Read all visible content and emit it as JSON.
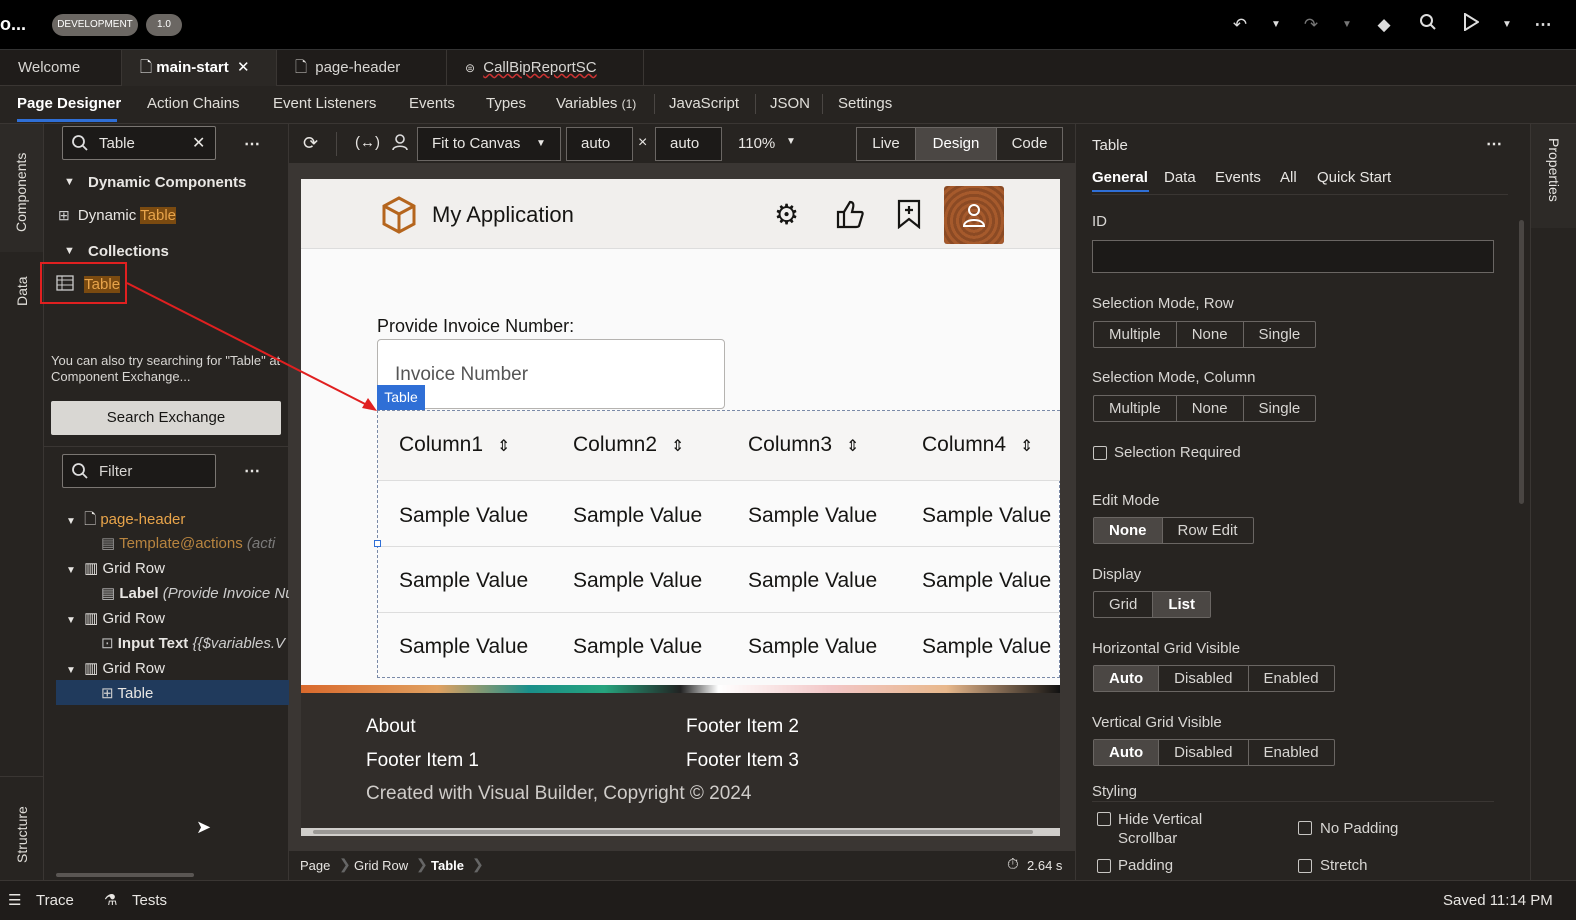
{
  "topbar": {
    "app_name": "o...",
    "env_badge": "DEVELOPMENT",
    "version_badge": "1.0"
  },
  "file_tabs": [
    {
      "label": "Welcome"
    },
    {
      "label": "main-start"
    },
    {
      "label": "page-header"
    },
    {
      "label": "CallBipReportSC"
    }
  ],
  "sub_tabs": [
    {
      "label": "Page Designer"
    },
    {
      "label": "Action Chains"
    },
    {
      "label": "Event Listeners"
    },
    {
      "label": "Events"
    },
    {
      "label": "Types"
    },
    {
      "label": "Variables",
      "count": "(1)"
    },
    {
      "label": "JavaScript"
    },
    {
      "label": "JSON"
    },
    {
      "label": "Settings"
    }
  ],
  "left_rail": {
    "components": "Components",
    "data": "Data",
    "structure": "Structure"
  },
  "components_panel": {
    "search_value": "Table",
    "group1": "Dynamic Components",
    "item1_prefix": "Dynamic ",
    "item1_match": "Table",
    "group2": "Collections",
    "item2_match": "Table",
    "exchange_hint": "You can also try searching for \"Table\" at Component Exchange...",
    "exchange_button": "Search Exchange"
  },
  "structure_panel": {
    "filter_placeholder": "Filter",
    "nodes": [
      {
        "label": "page-header"
      },
      {
        "label": "Template",
        "extra": "@actions",
        "note": "(acti"
      },
      {
        "label": "Grid Row"
      },
      {
        "label": "Label",
        "note": "(Provide Invoice Nu"
      },
      {
        "label": "Grid Row"
      },
      {
        "label": "Input Text",
        "note": "{{$variables.V"
      },
      {
        "label": "Grid Row"
      },
      {
        "label": "Table"
      }
    ]
  },
  "canvas_toolbar": {
    "fit": "Fit to Canvas",
    "width": "auto",
    "times": "×",
    "height": "auto",
    "zoom": "110%",
    "modes": [
      "Live",
      "Design",
      "Code"
    ],
    "active_mode": "Design"
  },
  "preview": {
    "app_title": "My Application",
    "field_label": "Provide Invoice Number:",
    "field_placeholder": "Invoice Number",
    "table_badge": "Table",
    "columns": [
      "Column1",
      "Column2",
      "Column3",
      "Column4"
    ],
    "rows": [
      [
        "Sample Value",
        "Sample Value",
        "Sample Value",
        "Sample Value"
      ],
      [
        "Sample Value",
        "Sample Value",
        "Sample Value",
        "Sample Value"
      ],
      [
        "Sample Value",
        "Sample Value",
        "Sample Value",
        "Sample Value"
      ]
    ],
    "footer": {
      "about": "About",
      "item1": "Footer Item 1",
      "item2": "Footer Item 2",
      "item3": "Footer Item 3",
      "copyright": "Created with Visual Builder, Copyright © 2024"
    }
  },
  "breadcrumb": {
    "items": [
      "Page",
      "Grid Row",
      "Table"
    ],
    "timing": "2.64 s"
  },
  "properties": {
    "title": "Table",
    "tabs": [
      "General",
      "Data",
      "Events",
      "All",
      "Quick Start"
    ],
    "id_label": "ID",
    "id_value": "",
    "sel_row_label": "Selection Mode, Row",
    "sel_col_label": "Selection Mode, Column",
    "sel_options": [
      "Multiple",
      "None",
      "Single"
    ],
    "sel_required": "Selection Required",
    "edit_mode_label": "Edit Mode",
    "edit_options": [
      "None",
      "Row Edit"
    ],
    "display_label": "Display",
    "display_options": [
      "Grid",
      "List"
    ],
    "hgrid_label": "Horizontal Grid Visible",
    "vgrid_label": "Vertical Grid Visible",
    "grid_options": [
      "Auto",
      "Disabled",
      "Enabled"
    ],
    "styling_label": "Styling",
    "hide_vscroll": "Hide Vertical Scrollbar",
    "hide_vscroll_1": "Hide Vertical",
    "hide_vscroll_2": "Scrollbar",
    "no_padding": "No Padding",
    "padding": "Padding",
    "stretch": "Stretch"
  },
  "right_rail": {
    "properties": "Properties"
  },
  "status": {
    "trace": "Trace",
    "tests": "Tests",
    "saved": "Saved 11:14 PM"
  },
  "colors": {
    "accent": "#2f6fd6",
    "selected_row": "#203a5c",
    "highlight": "#7a4a10",
    "annotation": "#e02020"
  }
}
